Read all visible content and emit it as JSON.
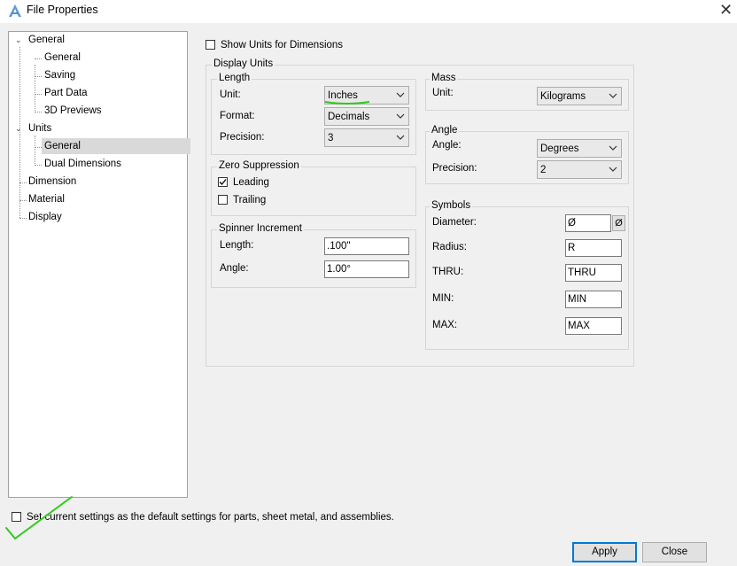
{
  "window": {
    "title": "File Properties",
    "close_glyph": "✕"
  },
  "tree": {
    "items": [
      {
        "label": "General"
      },
      {
        "label": "General"
      },
      {
        "label": "Saving"
      },
      {
        "label": "Part Data"
      },
      {
        "label": "3D Previews"
      },
      {
        "label": "Units"
      },
      {
        "label": "General"
      },
      {
        "label": "Dual Dimensions"
      },
      {
        "label": "Dimension"
      },
      {
        "label": "Material"
      },
      {
        "label": "Display"
      }
    ],
    "selected": "Units > General"
  },
  "show_units": {
    "label": "Show Units for Dimensions",
    "checked": false
  },
  "display_units": {
    "title": "Display Units",
    "length": {
      "title": "Length",
      "unit_label": "Unit:",
      "unit_value": "Inches",
      "format_label": "Format:",
      "format_value": "Decimals",
      "precision_label": "Precision:",
      "precision_value": "3"
    },
    "zero_suppression": {
      "title": "Zero Suppression",
      "leading_label": "Leading",
      "leading_checked": true,
      "trailing_label": "Trailing",
      "trailing_checked": false
    },
    "spinner": {
      "title": "Spinner Increment",
      "length_label": "Length:",
      "length_value": ".100\"",
      "angle_label": "Angle:",
      "angle_value": "1.00°"
    },
    "mass": {
      "title": "Mass",
      "unit_label": "Unit:",
      "unit_value": "Kilograms"
    },
    "angle": {
      "title": "Angle",
      "angle_label": "Angle:",
      "angle_value": "Degrees",
      "precision_label": "Precision:",
      "precision_value": "2"
    },
    "symbols": {
      "title": "Symbols",
      "diameter_label": "Diameter:",
      "diameter_value": "Ø",
      "diameter_button": "Ø",
      "radius_label": "Radius:",
      "radius_value": "R",
      "thru_label": "THRU:",
      "thru_value": "THRU",
      "min_label": "MIN:",
      "min_value": "MIN",
      "max_label": "MAX:",
      "max_value": "MAX"
    }
  },
  "default_settings": {
    "label": "Set current settings as the default settings for parts, sheet metal, and assemblies.",
    "checked": false
  },
  "buttons": {
    "apply": "Apply",
    "close": "Close"
  },
  "colors": {
    "annotation_green": "#2ecc1a",
    "accent": "#0078d7",
    "icon_blue": "#5b9bd5"
  }
}
